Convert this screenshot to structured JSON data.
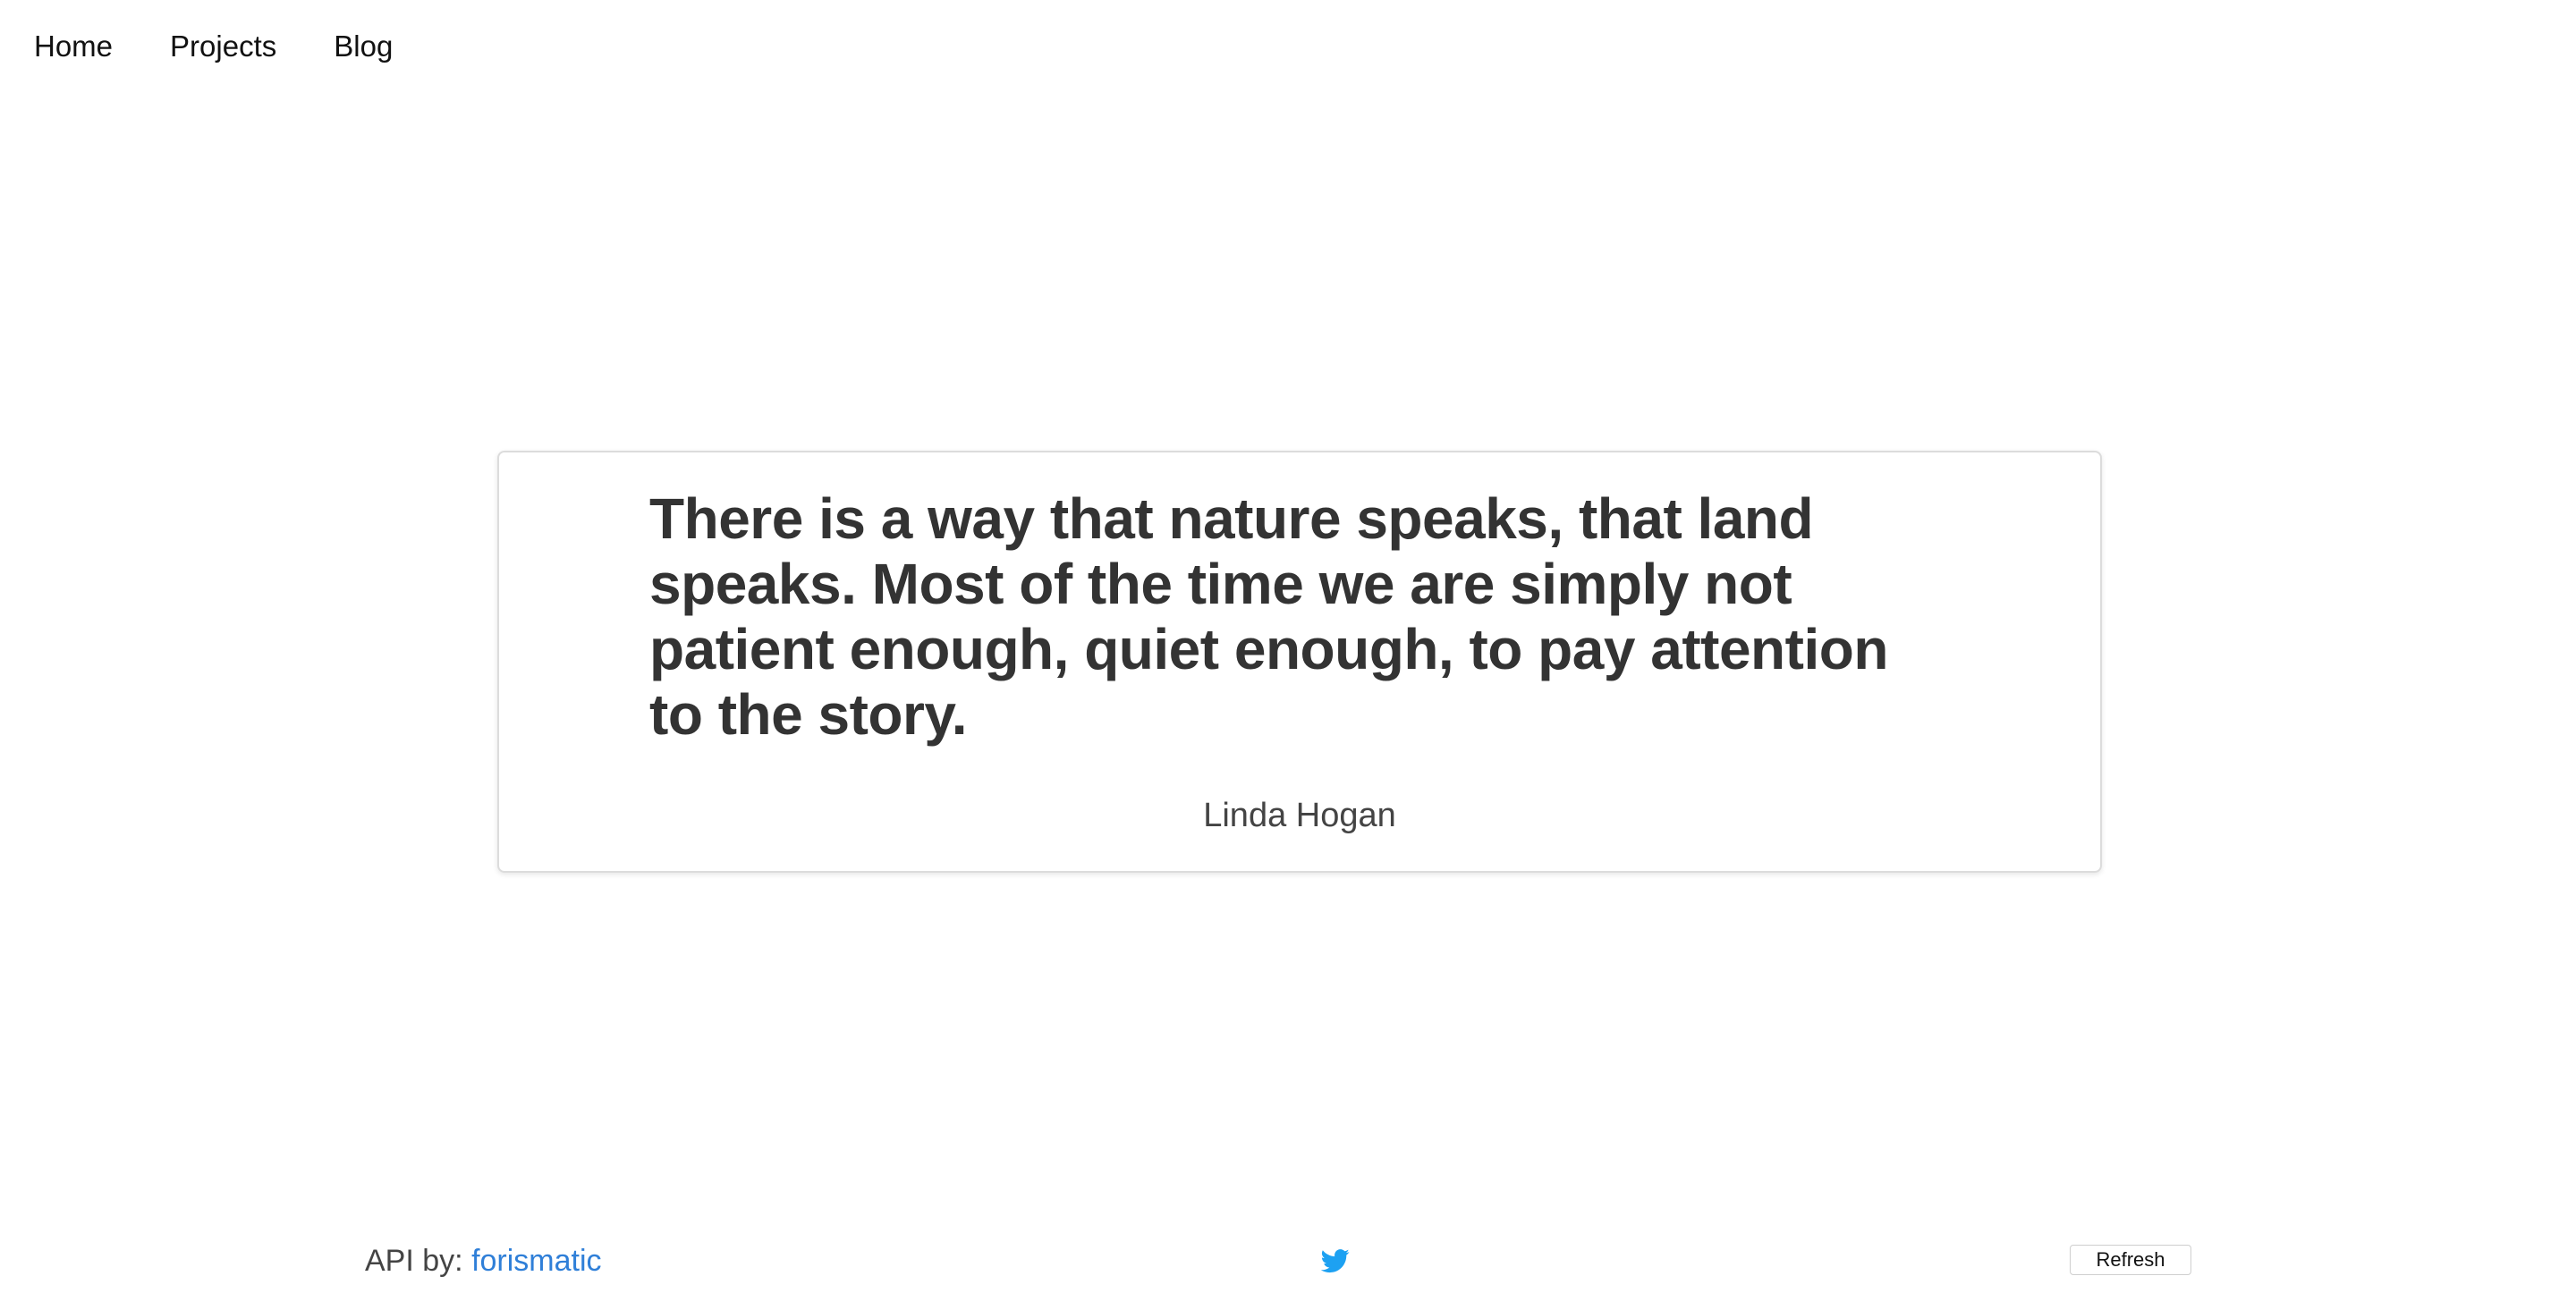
{
  "nav": {
    "items": [
      {
        "label": "Home"
      },
      {
        "label": "Projects"
      },
      {
        "label": "Blog"
      }
    ]
  },
  "quote": {
    "text": "There is a way that nature speaks, that land speaks. Most of the time we are simply not patient enough, quiet enough, to pay attention to the story.",
    "author": "Linda Hogan"
  },
  "footer": {
    "api_prefix": "API by:",
    "api_link": "forismatic",
    "tweet_icon": "twitter-bird-icon",
    "refresh_label": "Refresh"
  },
  "colors": {
    "link": "#2f7fd8",
    "twitter": "#1da1f2",
    "text": "#333333"
  }
}
